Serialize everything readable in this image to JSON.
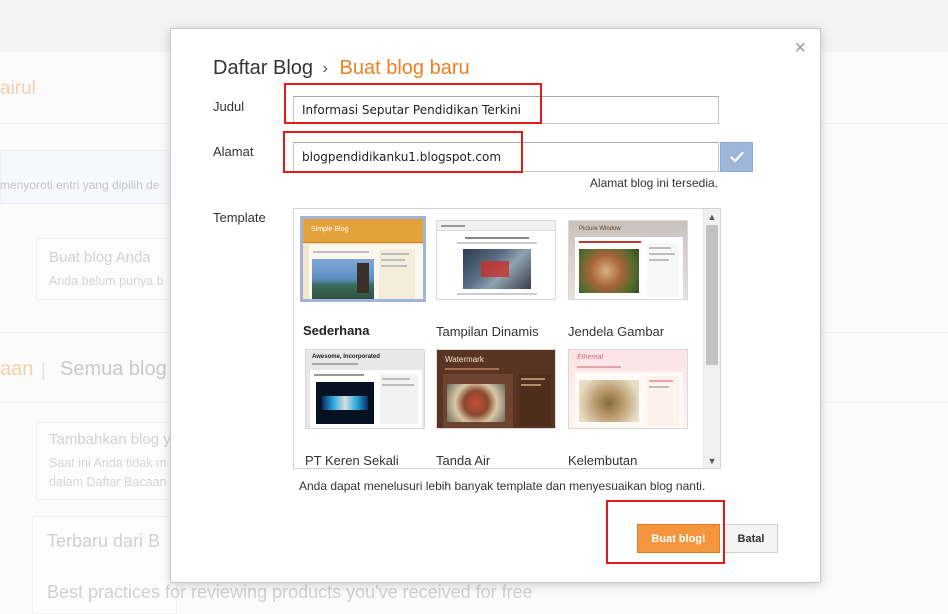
{
  "background": {
    "user_name_fragment": "airul",
    "info_text": "menyoroti entri yang dipilih de",
    "card1": {
      "title": "Buat blog Anda",
      "text": "Anda belum punya b"
    },
    "tabs": {
      "left": "aan",
      "divider": "|",
      "all_blogs": "Semua blog"
    },
    "card2": {
      "title": "Tambahkan blog y",
      "line1": "Saat ini Anda tidak m",
      "line2": "dalam Daftar Bacaan"
    },
    "latest": {
      "title": "Terbaru dari B",
      "post": "Best practices for reviewing products you've received for free"
    }
  },
  "dialog": {
    "breadcrumb_parent": "Daftar Blog",
    "breadcrumb_sep": "›",
    "title": "Buat blog baru",
    "close_icon": "×",
    "title_label": "Judul",
    "title_value": "Informasi Seputar Pendidikan Terkini",
    "address_label": "Alamat",
    "address_value": "blogpendidikanku1.blogspot.com",
    "address_status": "Alamat blog ini tersedia.",
    "check_icon": "check-icon",
    "template_label": "Template",
    "templates": [
      {
        "name": "Sederhana",
        "selected": true,
        "mini_title": "Simple Blog"
      },
      {
        "name": "Tampilan Dinamis",
        "selected": false,
        "mini_title": ""
      },
      {
        "name": "Jendela Gambar",
        "selected": false,
        "mini_title": "Picture Window"
      },
      {
        "name": "PT Keren Sekali",
        "selected": false,
        "mini_title": "Awesome, Incorporated"
      },
      {
        "name": "Tanda Air",
        "selected": false,
        "mini_title": "Watermark"
      },
      {
        "name": "Kelembutan",
        "selected": false,
        "mini_title": "Ethereal"
      }
    ],
    "template_hint": "Anda dapat menelusuri lebih banyak template dan menyesuaikan blog nanti.",
    "create_button": "Buat blog!",
    "cancel_button": "Batal"
  },
  "colors": {
    "accent": "#f07f1f",
    "primary_button": "#f4963d",
    "highlight": "#e21a1a",
    "check_button": "#9db6d9"
  }
}
